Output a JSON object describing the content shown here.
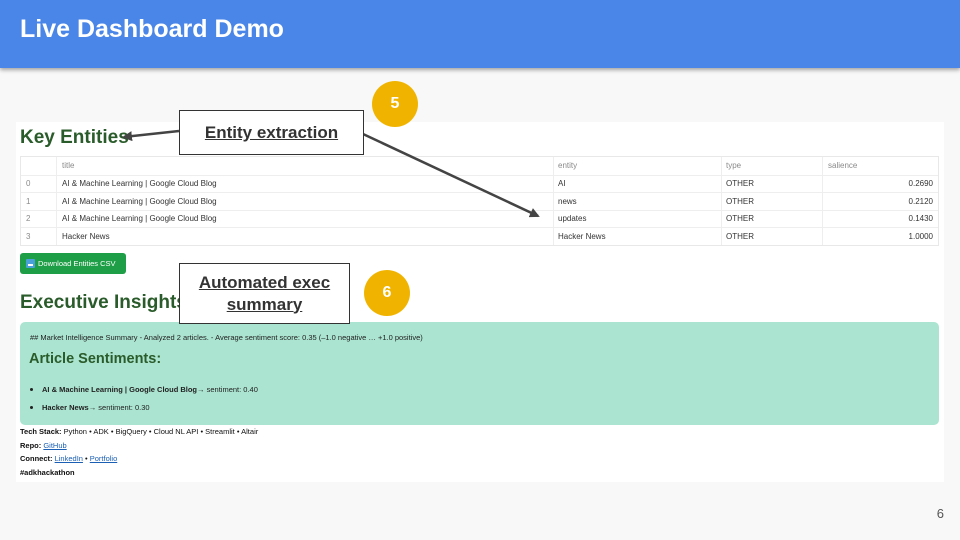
{
  "header": {
    "title": "Live Dashboard Demo"
  },
  "entities": {
    "heading": "Key Entities",
    "columns": {
      "index": "",
      "title": "title",
      "entity": "entity",
      "type": "type",
      "salience": "salience"
    },
    "rows": [
      {
        "index": "0",
        "title": "AI & Machine Learning | Google Cloud Blog",
        "entity": "AI",
        "type": "OTHER",
        "salience": "0.2690"
      },
      {
        "index": "1",
        "title": "AI & Machine Learning | Google Cloud Blog",
        "entity": "news",
        "type": "OTHER",
        "salience": "0.2120"
      },
      {
        "index": "2",
        "title": "AI & Machine Learning | Google Cloud Blog",
        "entity": "updates",
        "type": "OTHER",
        "salience": "0.1430"
      },
      {
        "index": "3",
        "title": "Hacker News",
        "entity": "Hacker News",
        "type": "OTHER",
        "salience": "1.0000"
      }
    ],
    "download_label": "Download Entities CSV"
  },
  "insights": {
    "heading": "Executive Insights",
    "summary": "## Market Intelligence Summary - Analyzed 2 articles. - Average sentiment score: 0.35 (–1.0 negative … +1.0 positive)",
    "sentiments_heading": "Article Sentiments:",
    "items": [
      {
        "name": "AI & Machine Learning | Google Cloud Blog",
        "text": " → sentiment: 0.40"
      },
      {
        "name": "Hacker News",
        "text": " → sentiment: 0.30"
      }
    ]
  },
  "footer": {
    "tech_label": "Tech Stack:",
    "tech_value": " Python • ADK • BigQuery • Cloud NL API • Streamlit • Altair",
    "repo_label": "Repo:",
    "repo_link": "GitHub",
    "connect_label": "Connect:",
    "connect_link1": "LinkedIn",
    "connect_sep": " • ",
    "connect_link2": "Portfolio",
    "hashtag": "#adkhackathon"
  },
  "callouts": {
    "entity": "Entity extraction",
    "exec_line1": "Automated exec",
    "exec_line2": "summary"
  },
  "badges": {
    "five": "5",
    "six": "6"
  },
  "slide_number": "6",
  "colors": {
    "header": "#4a86e8",
    "badge": "#f0b400",
    "heading_green": "#2a5b2a",
    "button_green": "#1e9e47",
    "insights_bg": "#abe4d1"
  }
}
